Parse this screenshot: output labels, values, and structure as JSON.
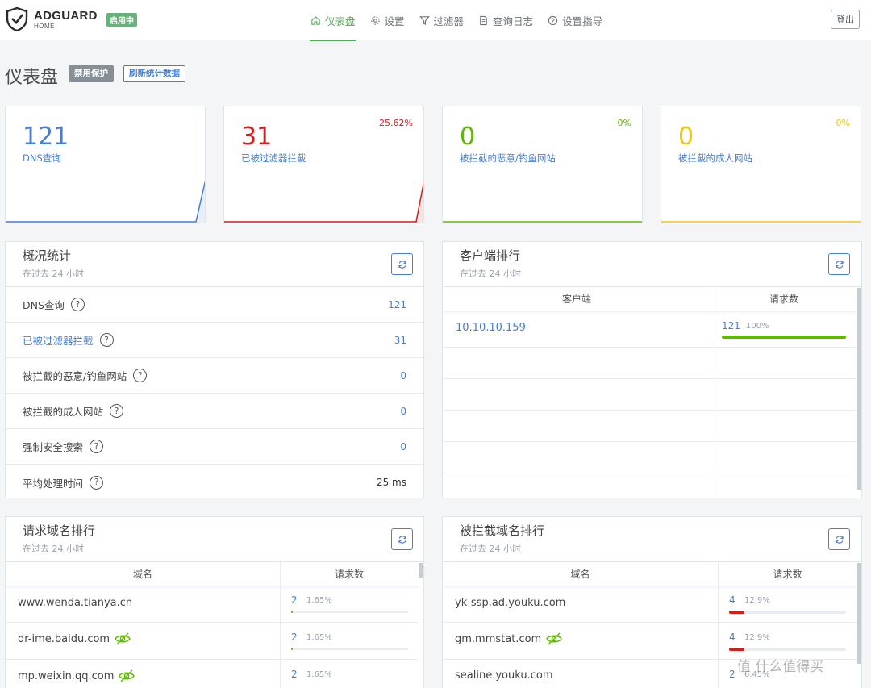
{
  "header": {
    "logo_main": "ADGUARD",
    "logo_sub": "HOME",
    "status_badge": "启用中",
    "nav": [
      {
        "label": "仪表盘",
        "icon": "home-icon",
        "active": true
      },
      {
        "label": "设置",
        "icon": "gear-icon",
        "active": false
      },
      {
        "label": "过滤器",
        "icon": "filter-icon",
        "active": false
      },
      {
        "label": "查询日志",
        "icon": "document-icon",
        "active": false
      },
      {
        "label": "设置指导",
        "icon": "help-circle-icon",
        "active": false
      }
    ],
    "logout": "登出"
  },
  "page": {
    "title": "仪表盘",
    "disable_protection": "禁用保护",
    "refresh_stats": "刷新统计数据"
  },
  "cards": [
    {
      "value": "121",
      "label": "DNS查询",
      "percent": "",
      "color": "#467fcf"
    },
    {
      "value": "31",
      "label": "已被过滤器拦截",
      "percent": "25.62%",
      "color": "#cd201f"
    },
    {
      "value": "0",
      "label": "被拦截的恶意/钓鱼网站",
      "percent": "0%",
      "color": "#5eba00"
    },
    {
      "value": "0",
      "label": "被拦截的成人网站",
      "percent": "0%",
      "color": "#f1c40f"
    }
  ],
  "overview": {
    "title": "概况统计",
    "subtitle": "在过去 24 小时",
    "rows": [
      {
        "label": "DNS查询",
        "value": "121"
      },
      {
        "label": "已被过滤器拦截",
        "value": "31"
      },
      {
        "label": "被拦截的恶意/钓鱼网站",
        "value": "0"
      },
      {
        "label": "被拦截的成人网站",
        "value": "0"
      },
      {
        "label": "强制安全搜索",
        "value": "0"
      },
      {
        "label": "平均处理时间",
        "value": "25 ms"
      }
    ],
    "help_glyph": "?"
  },
  "clients": {
    "title": "客户端排行",
    "subtitle": "在过去 24 小时",
    "col_client": "客户端",
    "col_requests": "请求数",
    "rows": [
      {
        "client": "10.10.10.159",
        "count": "121",
        "percent": "100%",
        "fill": 1.0
      }
    ]
  },
  "queried": {
    "title": "请求域名排行",
    "subtitle": "在过去 24 小时",
    "col_domain": "域名",
    "col_requests": "请求数",
    "rows": [
      {
        "domain": "www.wenda.tianya.cn",
        "count": "2",
        "percent": "1.65%",
        "fill": 0.0165,
        "tracker": false
      },
      {
        "domain": "dr-ime.baidu.com",
        "count": "2",
        "percent": "1.65%",
        "fill": 0.0165,
        "tracker": true
      },
      {
        "domain": "mp.weixin.qq.com",
        "count": "2",
        "percent": "1.65%",
        "fill": 0.0165,
        "tracker": true
      }
    ]
  },
  "blocked": {
    "title": "被拦截域名排行",
    "subtitle": "在过去 24 小时",
    "col_domain": "域名",
    "col_requests": "请求数",
    "rows": [
      {
        "domain": "yk-ssp.ad.youku.com",
        "count": "4",
        "percent": "12.9%",
        "fill": 0.129,
        "tracker": false
      },
      {
        "domain": "gm.mmstat.com",
        "count": "4",
        "percent": "12.9%",
        "fill": 0.129,
        "tracker": true
      },
      {
        "domain": "sealine.youku.com",
        "count": "2",
        "percent": "6.45%",
        "fill": 0.0645,
        "tracker": false
      }
    ]
  },
  "watermark": "值 什么值得买",
  "colors": {
    "green": "#58a55c",
    "blue": "#467fcf",
    "red": "#cd201f",
    "bar_green": "#5eba00"
  }
}
